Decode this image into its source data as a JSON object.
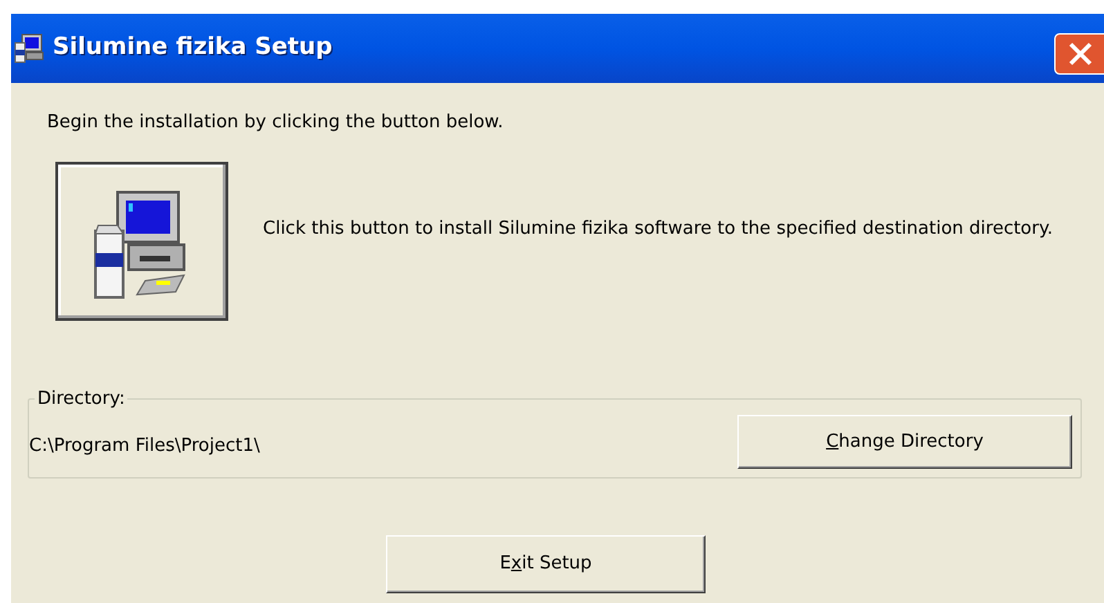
{
  "window": {
    "title": "Silumine fizika Setup"
  },
  "intro": "Begin the installation by clicking the button below.",
  "install": {
    "description": "Click this button to install Silumine fizika software to the specified destination directory."
  },
  "directory": {
    "label": "Directory:",
    "path": "C:\\Program Files\\Project1\\",
    "button": {
      "label": {
        "access_key": "C",
        "after": "hange Directory"
      }
    }
  },
  "exit_button": {
    "label": {
      "before": "E",
      "access_key": "x",
      "after": "it Setup"
    }
  }
}
